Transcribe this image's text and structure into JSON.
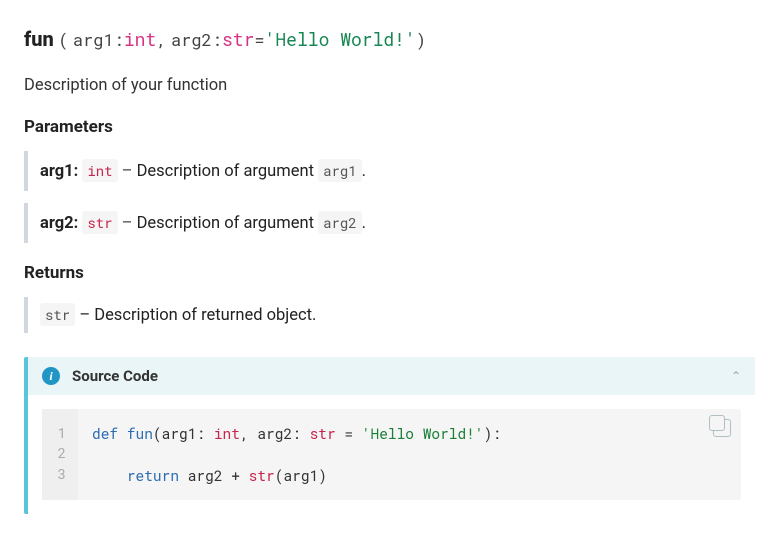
{
  "signature": {
    "name": "fun",
    "open": "(",
    "close": ")",
    "colon": ":",
    "comma": ",",
    "eq": "=",
    "args": [
      {
        "name": "arg1",
        "type": "int"
      },
      {
        "name": "arg2",
        "type": "str",
        "default": "'Hello World!'"
      }
    ]
  },
  "description": "Description of your function",
  "sections": {
    "parameters_label": "Parameters",
    "returns_label": "Returns"
  },
  "parameters": [
    {
      "name": "arg1:",
      "type_tag": "int",
      "dash": " – ",
      "desc": "Description of argument ",
      "ref": "arg1",
      "tail": "."
    },
    {
      "name": "arg2:",
      "type_tag": "str",
      "dash": " – ",
      "desc": "Description of argument ",
      "ref": "arg2",
      "tail": "."
    }
  ],
  "returns": {
    "type_tag": "str",
    "dash": " – ",
    "desc": "Description of returned object."
  },
  "source": {
    "panel_label": "Source Code",
    "info_glyph": "i",
    "chevron": "⌃",
    "line_numbers": [
      "1",
      "2",
      "3"
    ],
    "code": {
      "l1": {
        "def": "def",
        "sp1": " ",
        "fn": "fun",
        "open": "(arg1: ",
        "t1": "int",
        "mid": ", arg2: ",
        "t2": "str",
        "eq": " = ",
        "deflt": "'Hello World!'",
        "close": "):"
      },
      "l2": "",
      "l3": {
        "indent": "    ",
        "ret": "return",
        "mid": " arg2 + ",
        "cast": "str",
        "rest": "(arg1)"
      }
    }
  }
}
